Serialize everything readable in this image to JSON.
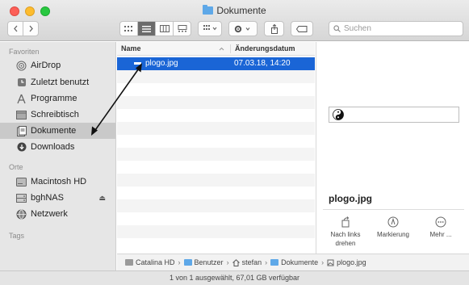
{
  "window": {
    "title": "Dokumente"
  },
  "search": {
    "placeholder": "Suchen"
  },
  "sidebar": {
    "sections": [
      {
        "title": "Favoriten"
      },
      {
        "title": "Orte"
      },
      {
        "title": "Tags"
      }
    ],
    "favorites": [
      {
        "label": "AirDrop",
        "icon": "airdrop-icon"
      },
      {
        "label": "Zuletzt benutzt",
        "icon": "recents-icon"
      },
      {
        "label": "Programme",
        "icon": "applications-icon"
      },
      {
        "label": "Schreibtisch",
        "icon": "desktop-icon"
      },
      {
        "label": "Dokumente",
        "icon": "documents-icon",
        "selected": true
      },
      {
        "label": "Downloads",
        "icon": "downloads-icon"
      }
    ],
    "places": [
      {
        "label": "Macintosh HD",
        "icon": "disk-icon"
      },
      {
        "label": "bghNAS",
        "icon": "server-icon",
        "eject": "⏏"
      },
      {
        "label": "Netzwerk",
        "icon": "network-icon"
      }
    ]
  },
  "list": {
    "columns": {
      "name": "Name",
      "date": "Änderungsdatum"
    },
    "rows": [
      {
        "name": "plogo.jpg",
        "date": "07.03.18, 14:20",
        "selected": true
      }
    ]
  },
  "preview": {
    "filename": "plogo.jpg",
    "actions": [
      {
        "label_line1": "Nach links",
        "label_line2": "drehen",
        "icon": "rotate-left-icon"
      },
      {
        "label_line1": "Markierung",
        "label_line2": "",
        "icon": "markup-icon"
      },
      {
        "label_line1": "Mehr ...",
        "label_line2": "",
        "icon": "more-icon"
      }
    ]
  },
  "pathbar": {
    "segments": [
      "Catalina HD",
      "Benutzer",
      "stefan",
      "Dokumente",
      "plogo.jpg"
    ]
  },
  "status": {
    "text": "1 von 1 ausgewählt, 67,01 GB verfügbar"
  },
  "colors": {
    "selection": "#1a65d6",
    "folder": "#5ea8e8",
    "annotation": "#111111"
  }
}
